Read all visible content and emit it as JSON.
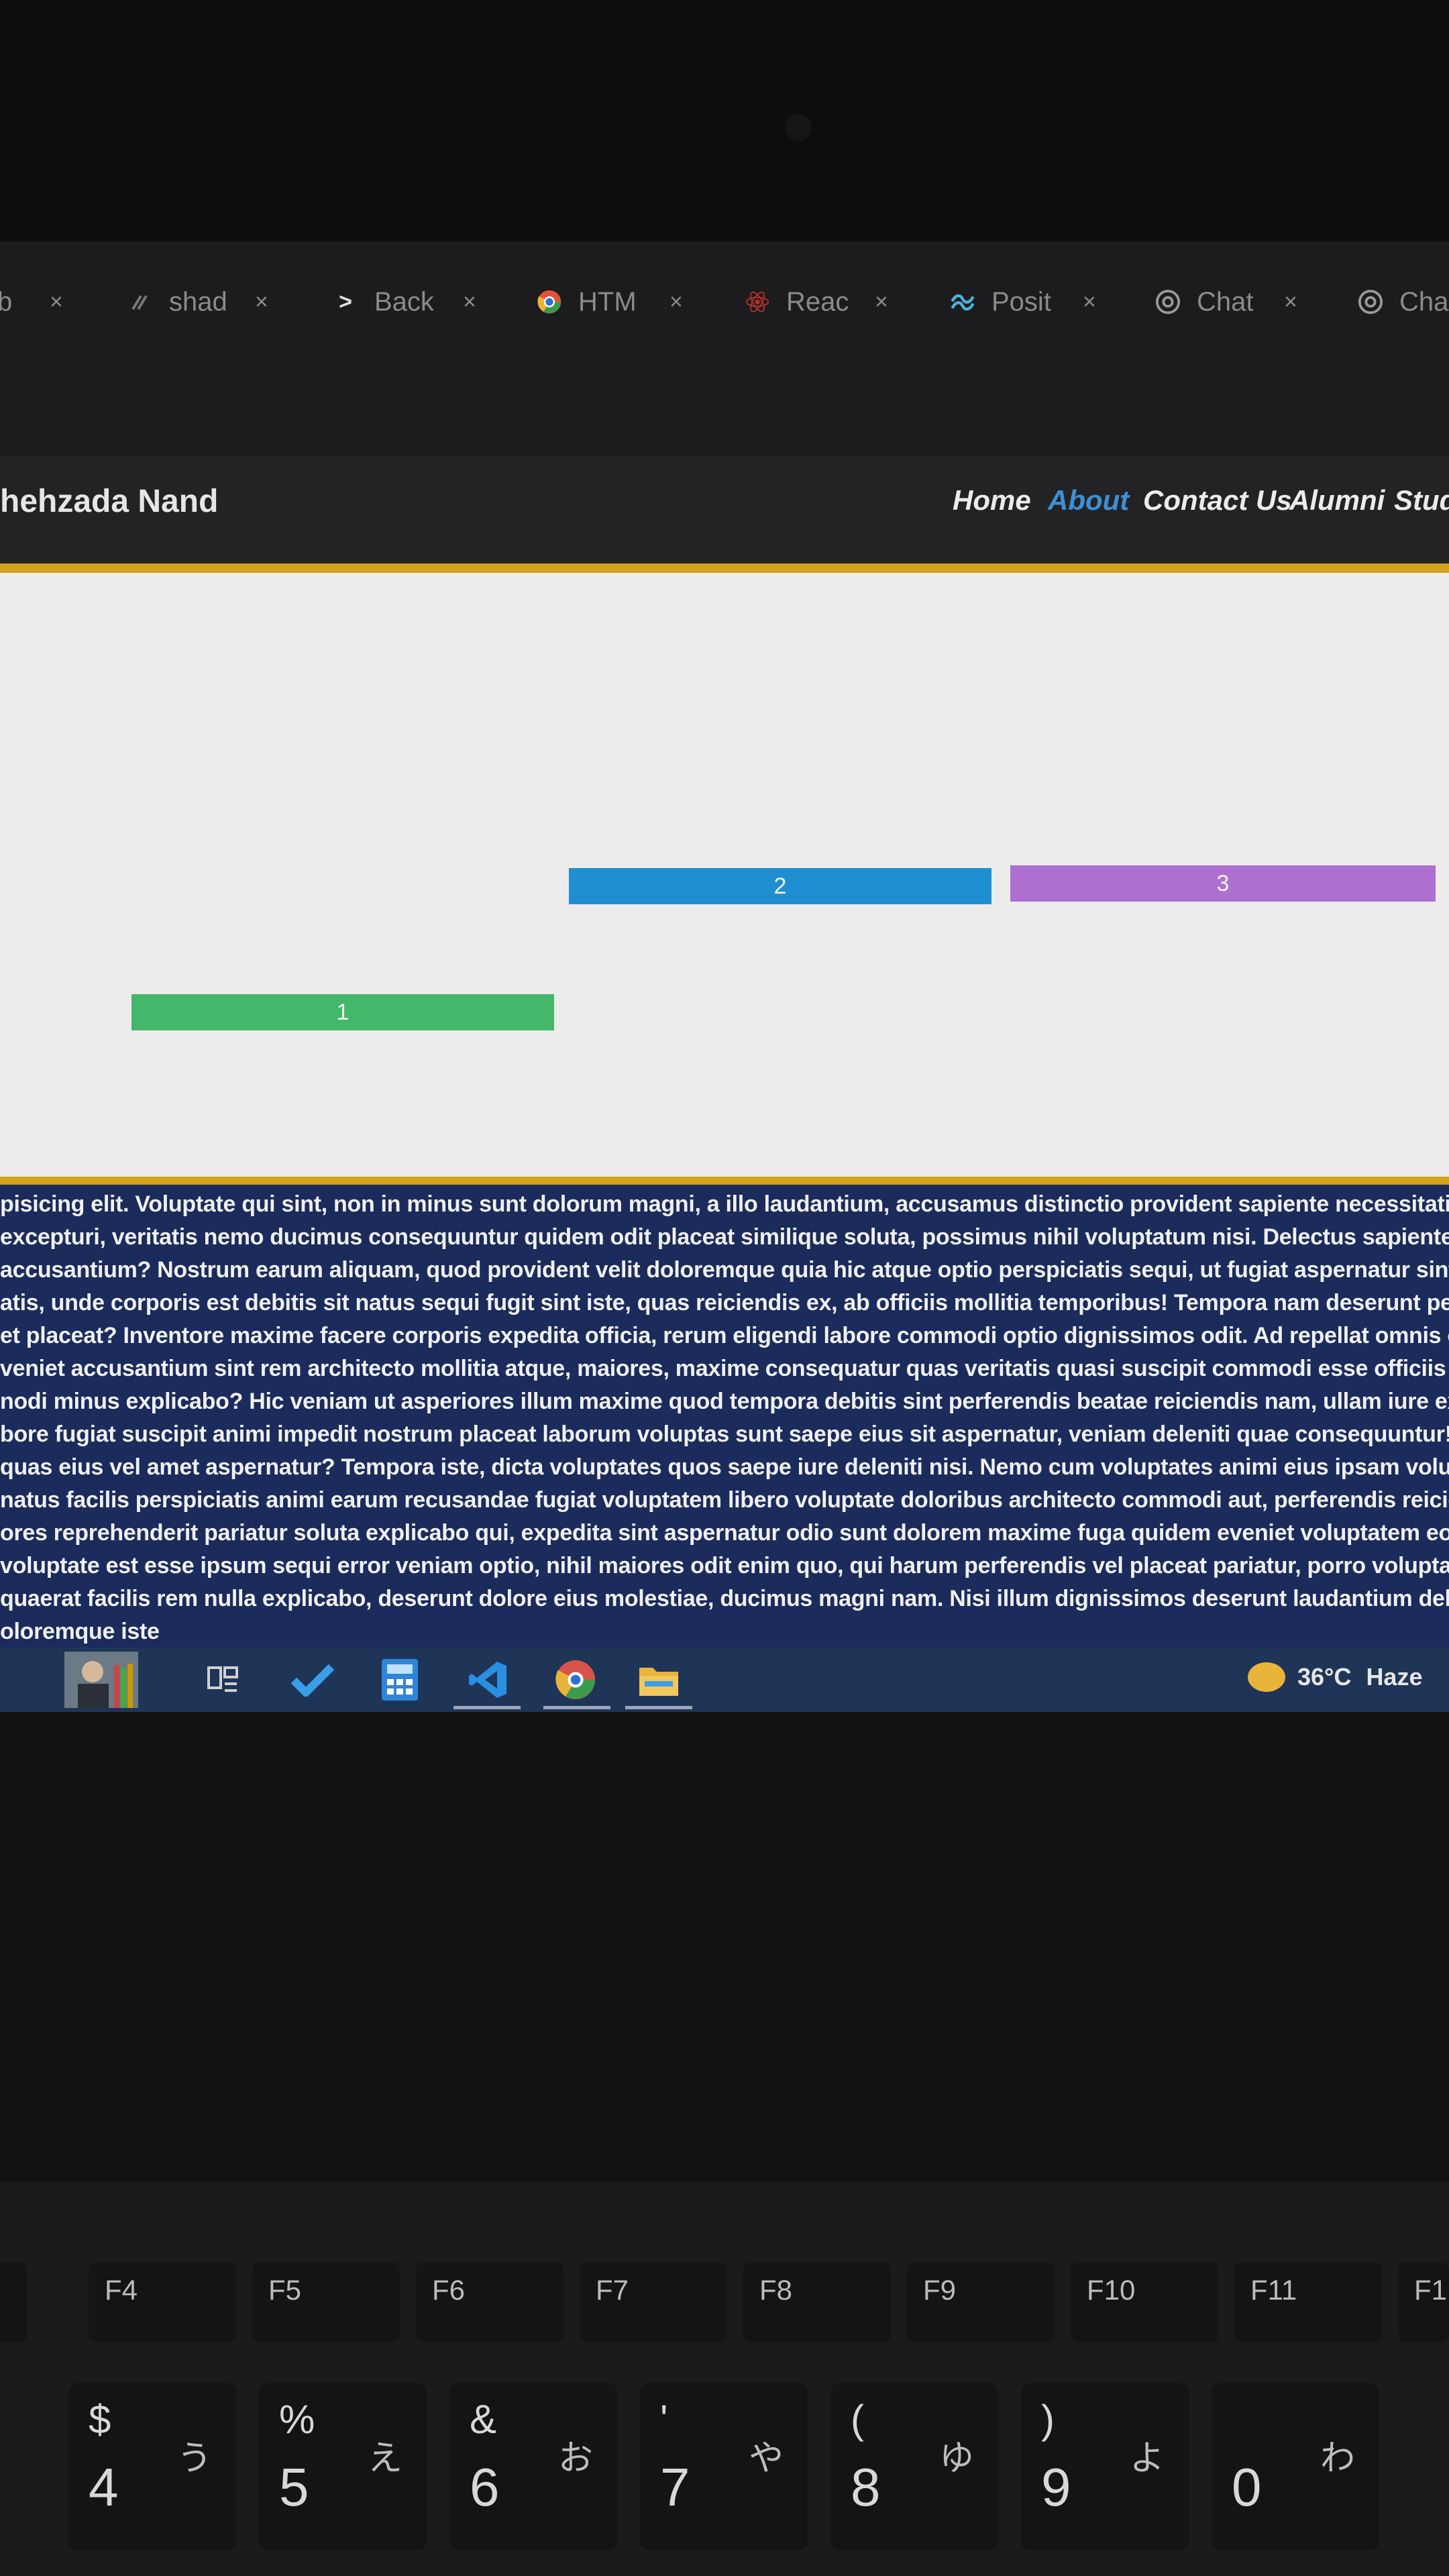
{
  "tabs": [
    {
      "label": "b",
      "icon": "tab-icon"
    },
    {
      "label": "shad",
      "icon": "slash-icon"
    },
    {
      "label": "Back",
      "icon": "chevron-right-icon"
    },
    {
      "label": "HTM",
      "icon": "chrome-icon"
    },
    {
      "label": "Reac",
      "icon": "react-icon"
    },
    {
      "label": "Posit",
      "icon": "tailwind-icon"
    },
    {
      "label": "Chat",
      "icon": "chatgpt-icon"
    },
    {
      "label": "Cha",
      "icon": "chatgpt-icon"
    }
  ],
  "tab_close": "×",
  "header": {
    "brand": "hehzada Nand",
    "nav": [
      "Home",
      "About",
      "Contact Us",
      "Alumni",
      "Stude"
    ],
    "active_nav": "About"
  },
  "colors": {
    "accent_gold": "#d4a21c",
    "nav_active": "#3d8fd6",
    "bar_green": "#44b76a",
    "bar_blue": "#1f8fd1",
    "bar_purple": "#ad6fd0",
    "text_bg": "#1a2b5c"
  },
  "grid_items": [
    {
      "label": "1",
      "color": "green"
    },
    {
      "label": "2",
      "color": "blue"
    },
    {
      "label": "3",
      "color": "purple"
    }
  ],
  "paragraph_lines": [
    "pisicing elit. Voluptate qui sint, non in minus sunt dolorum magni, a illo laudantium, accusamus distinctio provident sapiente necessitatibus",
    "excepturi, veritatis nemo ducimus consequuntur quidem odit placeat similique soluta, possimus nihil voluptatum nisi. Delectus sapiente co",
    "accusantium? Nostrum earum aliquam, quod provident velit doloremque quia hic atque optio perspiciatis sequi, ut fugiat aspernatur sint ve",
    "atis, unde corporis est debitis sit natus sequi fugit sint iste, quas reiciendis ex, ab officiis mollitia temporibus! Tempora nam deserunt perfere",
    "et placeat? Inventore maxime facere corporis expedita officia, rerum eligendi labore commodi optio dignissimos odit. Ad repellat omnis odit",
    "veniet accusantium sint rem architecto mollitia atque, maiores, maxime consequatur quas veritatis quasi suscipit commodi esse officiis repudi",
    "nodi minus explicabo? Hic veniam ut asperiores illum maxime quod tempora debitis sint perferendis beatae reiciendis nam, ullam iure exceptu",
    "bore fugiat suscipit animi impedit nostrum placeat laborum voluptas sunt saepe eius sit aspernatur, veniam deleniti quae consequuntur! Accus",
    "quas eius vel amet aspernatur? Tempora iste, dicta voluptates quos saepe iure deleniti nisi. Nemo cum voluptates animi eius ipsam voluptatibu",
    "natus facilis perspiciatis animi earum recusandae fugiat voluptatem libero voluptate doloribus architecto commodi aut, perferendis reiciendis is",
    "ores reprehenderit pariatur soluta explicabo qui, expedita sint aspernatur odio sunt dolorem maxime fuga quidem eveniet voluptatem eos! Fugit",
    "voluptate est esse ipsum sequi error veniam optio, nihil maiores odit enim quo, qui harum perferendis vel placeat pariatur, porro voluptates disti",
    "quaerat facilis rem nulla explicabo, deserunt dolore eius molestiae, ducimus magni nam. Nisi illum dignissimos deserunt laudantium debitis iusto",
    "oloremque iste"
  ],
  "taskbar": {
    "items": [
      "avatar",
      "task-view-icon",
      "todo-check-icon",
      "calculator-icon",
      "vscode-icon",
      "chrome-icon",
      "file-explorer-icon"
    ],
    "weather_temp": "36°C",
    "weather_desc": "Haze"
  },
  "keyboard": {
    "fkeys": [
      "F4",
      "F5",
      "F6",
      "F7",
      "F8",
      "F9",
      "F10",
      "F11",
      "F1"
    ],
    "numkeys": [
      {
        "top": "$",
        "bottom": "4",
        "kana": "う"
      },
      {
        "top": "%",
        "bottom": "5",
        "kana": "え"
      },
      {
        "top": "&",
        "bottom": "6",
        "kana": "お"
      },
      {
        "top": "'",
        "bottom": "7",
        "kana": "や"
      },
      {
        "top": "(",
        "bottom": "8",
        "kana": "ゆ"
      },
      {
        "top": ")",
        "bottom": "9",
        "kana": "よ"
      },
      {
        "top": "",
        "bottom": "0",
        "kana": "わ"
      }
    ]
  }
}
